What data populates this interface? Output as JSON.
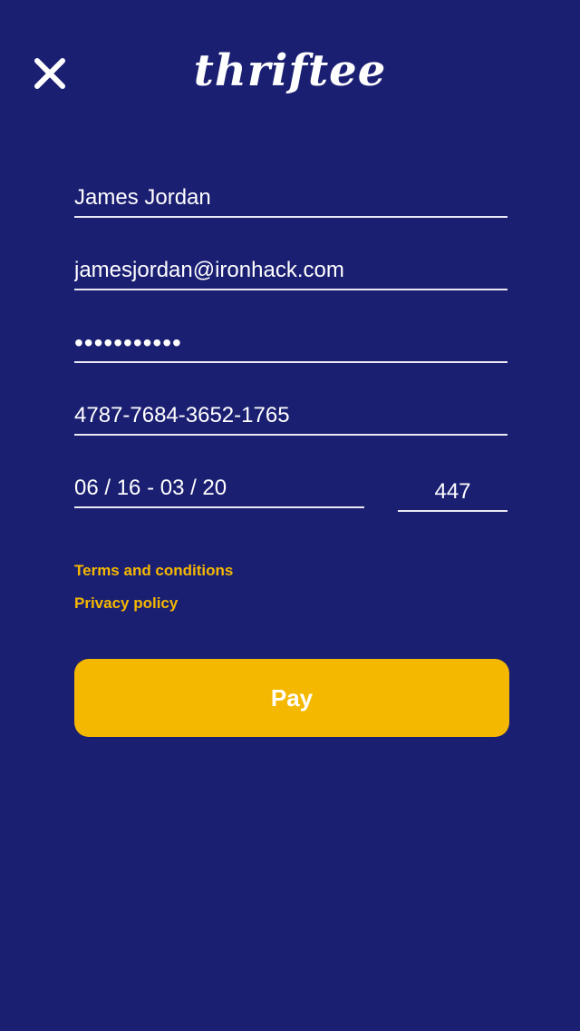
{
  "header": {
    "logo_text": "thriftee",
    "close_icon": "close-icon"
  },
  "form": {
    "name_value": "James Jordan",
    "email_value": "jamesjordan@ironhack.com",
    "password_value": "•••••••••••",
    "card_number_value": "4787-7684-3652-1765",
    "validity_value": "06 / 16 - 03 / 20",
    "cvv_value": "447"
  },
  "links": {
    "terms_label": "Terms and conditions",
    "privacy_label": "Privacy policy"
  },
  "actions": {
    "pay_label": "Pay"
  },
  "colors": {
    "background": "#1b1f72",
    "accent": "#f5b800",
    "text": "#ffffff"
  }
}
